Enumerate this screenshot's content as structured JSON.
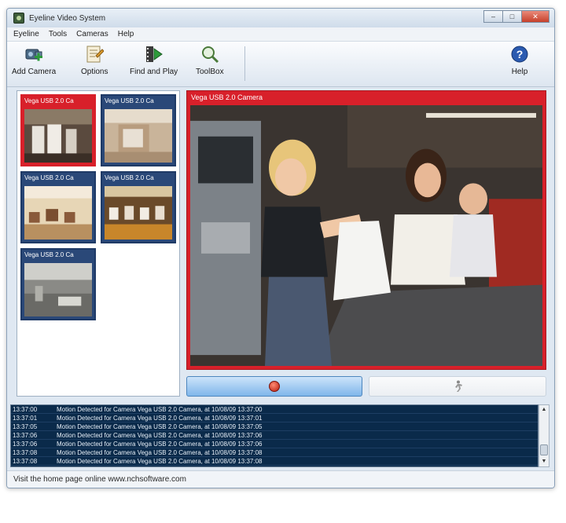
{
  "window": {
    "title": "Eyeline Video System"
  },
  "menu": [
    "Eyeline",
    "Tools",
    "Cameras",
    "Help"
  ],
  "toolbar": {
    "add_camera": "Add Camera",
    "options": "Options",
    "find_and_play": "Find and Play",
    "toolbox": "ToolBox",
    "help": "Help"
  },
  "thumbnails": [
    {
      "caption": "Vega USB 2.0 Ca",
      "active": true
    },
    {
      "caption": "Vega USB 2.0 Ca",
      "active": false
    },
    {
      "caption": "Vega USB 2.0 Ca",
      "active": false
    },
    {
      "caption": "Vega USB 2.0 Ca",
      "active": false
    },
    {
      "caption": "Vega USB 2.0 Ca",
      "active": false
    }
  ],
  "main_view": {
    "caption": "Vega USB 2.0 Camera"
  },
  "log": [
    {
      "time": "13:37:00",
      "message": "Motion Detected for Camera Vega USB 2.0 Camera, at 10/08/09 13:37:00"
    },
    {
      "time": "13:37:01",
      "message": "Motion Detected for Camera Vega USB 2.0 Camera, at 10/08/09 13:37:01"
    },
    {
      "time": "13:37:05",
      "message": "Motion Detected for Camera Vega USB 2.0 Camera, at 10/08/09 13:37:05"
    },
    {
      "time": "13:37:06",
      "message": "Motion Detected for Camera Vega USB 2.0 Camera, at 10/08/09 13:37:06"
    },
    {
      "time": "13:37:06",
      "message": "Motion Detected for Camera Vega USB 2.0 Camera, at 10/08/09 13:37:06"
    },
    {
      "time": "13:37:08",
      "message": "Motion Detected for Camera Vega USB 2.0 Camera, at 10/08/09 13:37:08"
    },
    {
      "time": "13:37:08",
      "message": "Motion Detected for Camera Vega USB 2.0 Camera, at 10/08/09 13:37:08"
    }
  ],
  "status": {
    "text": "Visit the home page online www.nchsoftware.com"
  },
  "colors": {
    "accent_red": "#d8202a",
    "navy": "#1f3a66",
    "log_bg": "#0a2a4a"
  }
}
